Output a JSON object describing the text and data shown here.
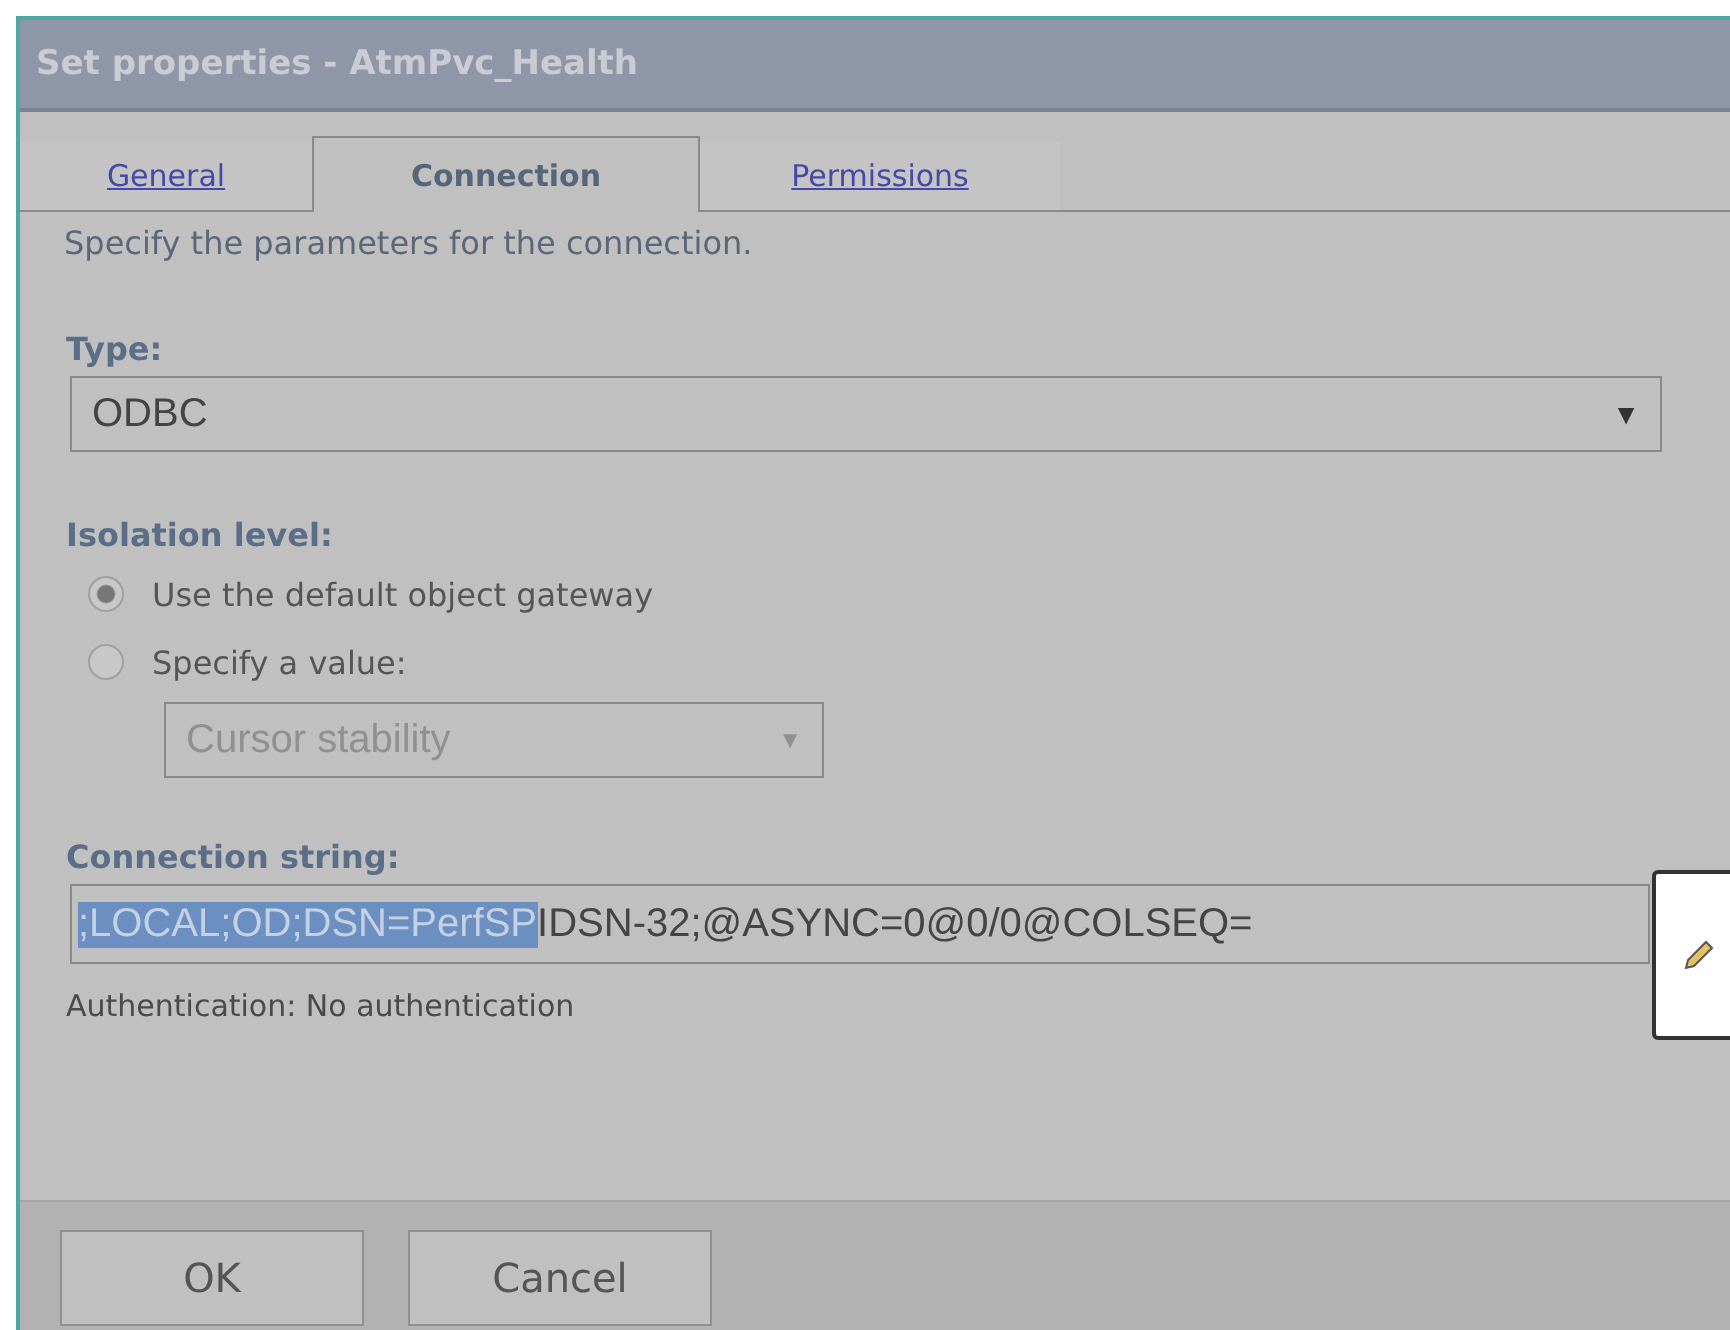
{
  "window": {
    "title": "Set properties - AtmPvc_Health"
  },
  "tabs": [
    {
      "label": "General",
      "selected": false
    },
    {
      "label": "Connection",
      "selected": true
    },
    {
      "label": "Permissions",
      "selected": false
    }
  ],
  "description": "Specify the parameters for the connection.",
  "type": {
    "label": "Type:",
    "value": "ODBC",
    "arrow": "▼"
  },
  "isolation": {
    "label": "Isolation level:",
    "options": [
      {
        "label": "Use the default object gateway",
        "selected": true
      },
      {
        "label": "Specify a value:",
        "selected": false
      }
    ],
    "value_select": {
      "value": "Cursor stability",
      "arrow": "▼",
      "disabled": true
    }
  },
  "connection_string": {
    "label": "Connection string:",
    "selected_text": ";LOCAL;OD;DSN=PerfSP",
    "rest_text": "IDSN-32;@ASYNC=0@0/0@COLSEQ="
  },
  "authentication": "Authentication: No authentication",
  "buttons": [
    "OK",
    "Cancel"
  ]
}
